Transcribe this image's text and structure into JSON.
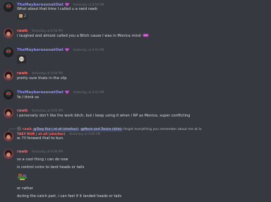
{
  "messages": {
    "m1": {
      "author": "TheMayberesonatOwl",
      "timestamp": "Yesterday at 8:56 PM",
      "text": "What about that time I called u a nerd rawb",
      "reaction_count": "2"
    },
    "m2": {
      "author": "rawb",
      "timestamp": "Yesterday at 8:59 PM",
      "text": "i laughed and almost called you a Bitch cause I was in Monica mind"
    },
    "m3": {
      "author": "TheMayberesonatOwl",
      "timestamp": "Yesterday at 9:04 PM"
    },
    "m4": {
      "author": "rawb",
      "timestamp": "Yesterday at 9:04 PM",
      "text": "pretty sure thats in the clip"
    },
    "m5": {
      "author": "TheMayberesonatOwl",
      "timestamp": "Yesterday at 9:04 PM",
      "text": "Ye I think so"
    },
    "m6": {
      "author": "rawb",
      "timestamp": "Yesterday at 9:05 PM",
      "text": "i personally don't like the work bitch, but i keep using it when i RP as Monica. super conflicting"
    },
    "m7": {
      "reply_author": "rawb",
      "reply_mention_1": "@Taey Rur | et all (she/hun)",
      "reply_mention_2": "@Maris and Tanice (it/its)",
      "reply_text": "forgot everything you remember about me at Io",
      "author": "TAEY RUR | et all (she/her)",
      "timestamp": "Yesterday at 9:06 PM",
      "text": "w. I'll forward that to bun."
    },
    "m8": {
      "author": "rawb",
      "timestamp": "Yesterday at 9:06 PM",
      "line1": "so a cool thing i can do now",
      "line2": "is control coins to land heads or tails",
      "line3": "or rather",
      "line4": "during the catch part, i can feel if it landed heads or tails"
    }
  },
  "colors": {
    "background": "#36393f",
    "owl_name": "#8f8ef5",
    "rawb_name": "#ff6b6b",
    "text": "#dcddde",
    "timestamp": "#72767d",
    "mention_highlight": "#faa61a"
  }
}
